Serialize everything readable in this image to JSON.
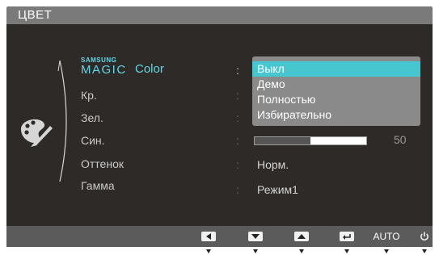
{
  "header": {
    "title": "ЦВЕТ"
  },
  "menu": {
    "magic_color": {
      "brand": "SAMSUNG",
      "magic": "MAGIC",
      "label": "Color"
    },
    "red": "Кр.",
    "green": "Зел.",
    "blue": "Син.",
    "tone": "Оттенок",
    "gamma": "Гамма",
    "colon": ":"
  },
  "dropdown": {
    "options": [
      "Выкл",
      "Демо",
      "Полностью",
      "Избирательно"
    ],
    "selected": "Выкл"
  },
  "blue_slider": {
    "value": "50",
    "fill_fraction": 0.5
  },
  "tone_value": "Норм.",
  "gamma_value": "Режим1",
  "controls": {
    "left_icon": "left-arrow-icon",
    "down_icon": "down-arrow-icon",
    "up_icon": "up-arrow-icon",
    "enter_icon": "enter-icon",
    "auto_label": "AUTO",
    "power_icon": "power-icon"
  },
  "colors": {
    "panel_bg": "#2e2a27",
    "header_bg": "#7a7a7a",
    "accent": "#5fd8e6",
    "dropdown_bg": "#8a8a8a",
    "dropdown_selected": "#46c6cf",
    "footer_bg": "#5b5b5b"
  }
}
